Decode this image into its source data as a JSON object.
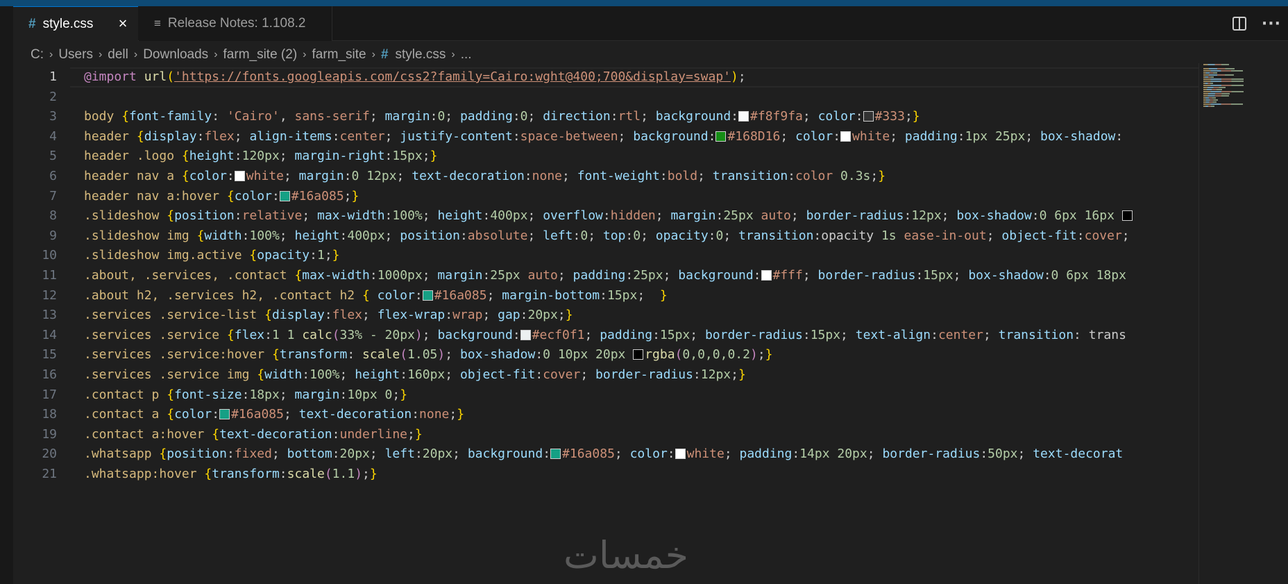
{
  "tabs": [
    {
      "label": "style.css",
      "icon": "#",
      "active": true
    },
    {
      "label": "Release Notes: 1.108.2",
      "icon": "≡",
      "active": false
    }
  ],
  "tab_close": "×",
  "breadcrumb": {
    "items": [
      "C:",
      "Users",
      "dell",
      "Downloads",
      "farm_site (2)",
      "farm_site"
    ],
    "file_icon": "#",
    "file": "style.css",
    "tail": "...",
    "separator": "›"
  },
  "editor": {
    "line_numbers": [
      "1",
      "2",
      "3",
      "4",
      "5",
      "6",
      "7",
      "8",
      "9",
      "10",
      "11",
      "12",
      "13",
      "14",
      "15",
      "16",
      "17",
      "18",
      "19",
      "20",
      "21"
    ],
    "current_line": 1,
    "swatch_colors": {
      "f8f9fa": "#f8f9fa",
      "c333": "#333333",
      "c168D16": "#168D16",
      "white": "#ffffff",
      "c16a085": "#16a085",
      "fff": "#ffffff",
      "ecf0f1": "#ecf0f1",
      "rgba": "#000000"
    }
  },
  "watermark": "خمسات",
  "colors": {
    "accent": "#0078d4",
    "selector": "#d7ba7d",
    "property": "#9cdcfe",
    "value": "#ce9178",
    "number": "#b5cea8",
    "bracket": "#ffd700",
    "at_rule": "#c586c0",
    "function": "#dcdcaa"
  },
  "code": {
    "l1": {
      "at": "@import",
      "fn": "url",
      "str": "'https://fonts.googleapis.com/css2?family=Cairo:wght@400;700&display=swap'"
    },
    "l3": {
      "sel": "body",
      "t1": "font-family",
      "v1": "'Cairo'",
      "v1b": "sans-serif",
      "t2": "margin",
      "n2": "0",
      "t3": "padding",
      "n3": "0",
      "t4": "direction",
      "v4": "rtl",
      "t5": "background",
      "v5": "#f8f9fa",
      "t6": "color",
      "v6": "#333"
    },
    "l4": {
      "sel": "header",
      "t1": "display",
      "v1": "flex",
      "t2": "align-items",
      "v2": "center",
      "t3": "justify-content",
      "v3": "space-between",
      "t4": "background",
      "v4": "#168D16",
      "t5": "color",
      "v5": "white",
      "t6": "padding",
      "n6": "1px 25px",
      "t7": "box-shadow"
    },
    "l5": {
      "sel": "header .logo",
      "t1": "height",
      "n1": "120px",
      "t2": "margin-right",
      "n2": "15px"
    },
    "l6": {
      "sel": "header nav a",
      "t1": "color",
      "v1": "white",
      "t2": "margin",
      "n2": "0 12px",
      "t3": "text-decoration",
      "v3": "none",
      "t4": "font-weight",
      "v4": "bold",
      "t5": "transition",
      "v5": "color",
      "n5": "0.3s"
    },
    "l7": {
      "sel": "header nav a:hover",
      "t1": "color",
      "v1": "#16a085"
    },
    "l8": {
      "sel": ".slideshow",
      "t1": "position",
      "v1": "relative",
      "t2": "max-width",
      "n2": "100%",
      "t3": "height",
      "n3": "400px",
      "t4": "overflow",
      "v4": "hidden",
      "t5": "margin",
      "n5": "25px",
      "v5": "auto",
      "t6": "border-radius",
      "n6": "12px",
      "t7": "box-shadow",
      "n7": "0 6px 16px"
    },
    "l9": {
      "sel": ".slideshow img",
      "t1": "width",
      "n1": "100%",
      "t2": "height",
      "n2": "400px",
      "t3": "position",
      "v3": "absolute",
      "t4": "left",
      "n4": "0",
      "t5": "top",
      "n5": "0",
      "t6": "opacity",
      "n6": "0",
      "t7": "transition",
      "v7": "opacity",
      "n7": "1s",
      "v7b": "ease-in-out",
      "t8": "object-fit",
      "v8": "cover"
    },
    "l10": {
      "sel": ".slideshow img.active",
      "t1": "opacity",
      "n1": "1"
    },
    "l11": {
      "sel": ".about, .services, .contact",
      "t1": "max-width",
      "n1": "1000px",
      "t2": "margin",
      "n2": "25px",
      "v2": "auto",
      "t3": "padding",
      "n3": "25px",
      "t4": "background",
      "v4": "#fff",
      "t5": "border-radius",
      "n5": "15px",
      "t6": "box-shadow",
      "n6": "0 6px 18px"
    },
    "l12": {
      "sel": ".about h2, .services h2, .contact h2",
      "t1": "color",
      "v1": "#16a085",
      "t2": "margin-bottom",
      "n2": "15px"
    },
    "l13": {
      "sel": ".services .service-list",
      "t1": "display",
      "v1": "flex",
      "t2": "flex-wrap",
      "v2": "wrap",
      "t3": "gap",
      "n3": "20px"
    },
    "l14": {
      "sel": ".services .service",
      "t1": "flex",
      "n1": "1 1",
      "f1": "calc",
      "n1b": "33% - 20px",
      "t2": "background",
      "v2": "#ecf0f1",
      "t3": "padding",
      "n3": "15px",
      "t4": "border-radius",
      "n4": "15px",
      "t5": "text-align",
      "v5": "center",
      "t6": "transition",
      "v6": "trans"
    },
    "l15": {
      "sel": ".services .service:hover",
      "t1": "transform",
      "f1": "scale",
      "n1": "1.05",
      "t2": "box-shadow",
      "n2": "0 10px 20px",
      "f2": "rgba",
      "n2b": "0,0,0,0.2"
    },
    "l16": {
      "sel": ".services .service img",
      "t1": "width",
      "n1": "100%",
      "t2": "height",
      "n2": "160px",
      "t3": "object-fit",
      "v3": "cover",
      "t4": "border-radius",
      "n4": "12px"
    },
    "l17": {
      "sel": ".contact p",
      "t1": "font-size",
      "n1": "18px",
      "t2": "margin",
      "n2": "10px 0"
    },
    "l18": {
      "sel": ".contact a",
      "t1": "color",
      "v1": "#16a085",
      "t2": "text-decoration",
      "v2": "none"
    },
    "l19": {
      "sel": ".contact a:hover",
      "t1": "text-decoration",
      "v1": "underline"
    },
    "l20": {
      "sel": ".whatsapp",
      "t1": "position",
      "v1": "fixed",
      "t2": "bottom",
      "n2": "20px",
      "t3": "left",
      "n3": "20px",
      "t4": "background",
      "v4": "#16a085",
      "t5": "color",
      "v5": "white",
      "t6": "padding",
      "n6": "14px 20px",
      "t7": "border-radius",
      "n7": "50px",
      "t8": "text-decorat"
    },
    "l21": {
      "sel": ".whatsapp:hover",
      "t1": "transform",
      "f1": "scale",
      "n1": "1.1"
    }
  }
}
